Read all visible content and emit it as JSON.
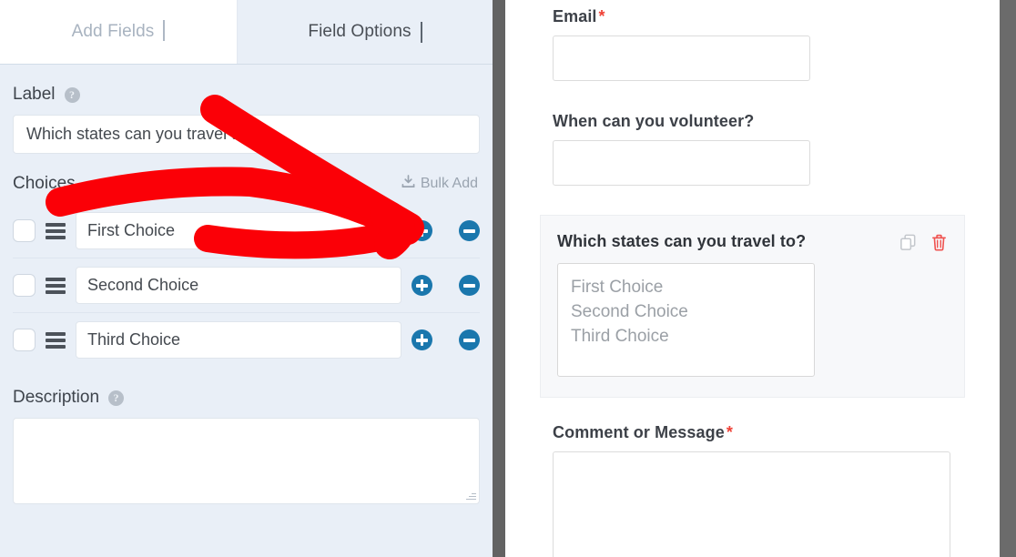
{
  "builder": {
    "tabs": [
      {
        "label": "Add Fields",
        "icon": "chevron-right-icon",
        "active": false
      },
      {
        "label": "Field Options",
        "icon": "chevron-down-icon",
        "active": true
      }
    ],
    "label_section": {
      "title": "Label",
      "help_icon": "help-circle-icon",
      "value": "Which states can you travel to?",
      "placeholder": ""
    },
    "choices_section": {
      "title": "Choices",
      "bulk_add_label": "Bulk Add",
      "bulk_add_icon": "download-tray-icon",
      "rows": [
        {
          "checked": false,
          "value": "First Choice",
          "drag_icon": "drag-handle-icon",
          "add_icon": "plus-circle-icon",
          "remove_icon": "minus-circle-icon"
        },
        {
          "checked": false,
          "value": "Second Choice",
          "drag_icon": "drag-handle-icon",
          "add_icon": "plus-circle-icon",
          "remove_icon": "minus-circle-icon"
        },
        {
          "checked": false,
          "value": "Third Choice",
          "drag_icon": "drag-handle-icon",
          "add_icon": "plus-circle-icon",
          "remove_icon": "minus-circle-icon"
        }
      ]
    },
    "description_section": {
      "title": "Description",
      "help_icon": "help-circle-icon",
      "value": "",
      "placeholder": ""
    }
  },
  "preview": {
    "fields": [
      {
        "label": "Email",
        "required": true,
        "required_mark": "*",
        "type": "text"
      },
      {
        "label": "When can you volunteer?",
        "required": false,
        "required_mark": "",
        "type": "text"
      }
    ],
    "active_field": {
      "label": "Which states can you travel to?",
      "duplicate_icon": "duplicate-icon",
      "delete_icon": "trash-icon",
      "options": [
        "First Choice",
        "Second Choice",
        "Third Choice"
      ]
    },
    "last_field": {
      "label": "Comment or Message",
      "required": true,
      "required_mark": "*",
      "type": "textarea"
    }
  },
  "annotation": {
    "type": "arrow",
    "color": "#fb0007",
    "points_to": "Bulk Add"
  },
  "colors": {
    "panel_bg": "#e9eff7",
    "accent_blue": "#1a77ad",
    "required_red": "#ef4136",
    "annotation_red": "#fb0007",
    "divider_gray": "#636363"
  }
}
